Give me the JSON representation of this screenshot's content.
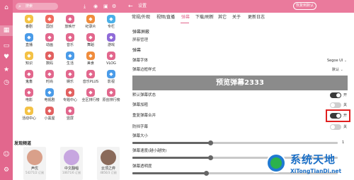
{
  "colors": {
    "brand": "#e2678d",
    "highlight": "#e02020"
  },
  "left_top": {
    "search_text": "搜索",
    "search_icon": "search-icon"
  },
  "left_top_icons": [
    "download-icon",
    "coin-icon",
    "bag-icon",
    "settings-label"
  ],
  "right_top": {
    "title": "设置",
    "restore_label": "恢复到默认"
  },
  "rail_items": [
    {
      "icon": "home-icon",
      "selected": false
    },
    {
      "icon": "grid-icon",
      "selected": true
    },
    {
      "icon": "tv-icon",
      "selected": false
    },
    {
      "icon": "heart-icon",
      "selected": false
    },
    {
      "icon": "star-icon",
      "selected": false
    },
    {
      "icon": "clock-icon",
      "selected": false
    },
    {
      "icon": "user-icon",
      "selected": false
    },
    {
      "icon": "settings-icon",
      "selected": false
    }
  ],
  "categories": [
    {
      "label": "番剧",
      "color": "#f4c245"
    },
    {
      "label": "国创",
      "color": "#ef6b5e"
    },
    {
      "label": "放映厅",
      "color": "#e2678d"
    },
    {
      "label": "纪录片",
      "color": "#f08c3c"
    },
    {
      "label": "专栏",
      "color": "#4cb0e8"
    },
    {
      "label": "直播",
      "color": "#4a9be8"
    },
    {
      "label": "动画",
      "color": "#e2678d"
    },
    {
      "label": "音乐",
      "color": "#e2678d"
    },
    {
      "label": "舞蹈",
      "color": "#e2678d"
    },
    {
      "label": "游戏",
      "color": "#8f6bd8"
    },
    {
      "label": "知识",
      "color": "#f4c245"
    },
    {
      "label": "数码",
      "color": "#e26060"
    },
    {
      "label": "生活",
      "color": "#4a9be8"
    },
    {
      "label": "美食",
      "color": "#f08c3c"
    },
    {
      "label": "VLOG",
      "color": "#e2678d"
    },
    {
      "label": "鬼畜",
      "color": "#e2678d"
    },
    {
      "label": "时尚",
      "color": "#e2678d"
    },
    {
      "label": "娱乐",
      "color": "#e2678d"
    },
    {
      "label": "音乐PLUS",
      "color": "#e2678d"
    },
    {
      "label": "影视",
      "color": "#4a9be8"
    },
    {
      "label": "电影",
      "color": "#e2678d"
    },
    {
      "label": "电视剧",
      "color": "#4a9be8"
    },
    {
      "label": "专题中心",
      "color": "#e26060"
    },
    {
      "label": "全区排行榜",
      "color": "#e2678d"
    },
    {
      "label": "原创排行榜",
      "color": "#e2678d"
    },
    {
      "label": "活动中心",
      "color": "#f4c245"
    },
    {
      "label": "小黑屋",
      "color": "#e26060"
    },
    {
      "label": "竖屏",
      "color": "#e2678d"
    }
  ],
  "discover_title": "发现频道",
  "anchors": [
    {
      "name": "声优",
      "count": "54271/2 订阅",
      "color": "#d9a08a"
    },
    {
      "name": "中文翻唱",
      "count": "10671/6 订阅",
      "color": "#c7a6e0"
    },
    {
      "name": "云顶之弈",
      "count": "4856/3 订阅",
      "color": "#8a6a5a"
    }
  ],
  "tabs": [
    "常规/外观",
    "视频/直播",
    "弹幕",
    "下载/刷新",
    "其它",
    "关于",
    "更新日志"
  ],
  "active_tab": "弹幕",
  "danmaku": {
    "block_head": "弹幕屏蔽",
    "block_manage": "屏蔽管理",
    "section_head": "弹幕",
    "font_label": "弹幕字体",
    "font_value": "Segoe UI",
    "border_label": "弹幕边框样式",
    "border_value": "默认",
    "preview_text": "预览弹幕2333",
    "rows": [
      {
        "label": "默认弹幕状态",
        "state": "on",
        "state_text": "开"
      },
      {
        "label": "弹幕加粗",
        "state": "off",
        "state_text": "关"
      },
      {
        "label": "重复弹幕合并",
        "state": "on",
        "state_text": "开"
      },
      {
        "label": "防挡字幕",
        "state": "off",
        "state_text": "关"
      }
    ],
    "sliders": [
      {
        "label": "弹幕大小",
        "value": "1",
        "fraction": 0.38
      },
      {
        "label": "弹幕速度(越小越快)",
        "value": "",
        "fraction": 0.38
      },
      {
        "label": "弹幕透明度",
        "value": "",
        "fraction": 0.36
      }
    ]
  },
  "watermark": {
    "title": "系统天地",
    "url": "XiTongTianDi.net"
  }
}
